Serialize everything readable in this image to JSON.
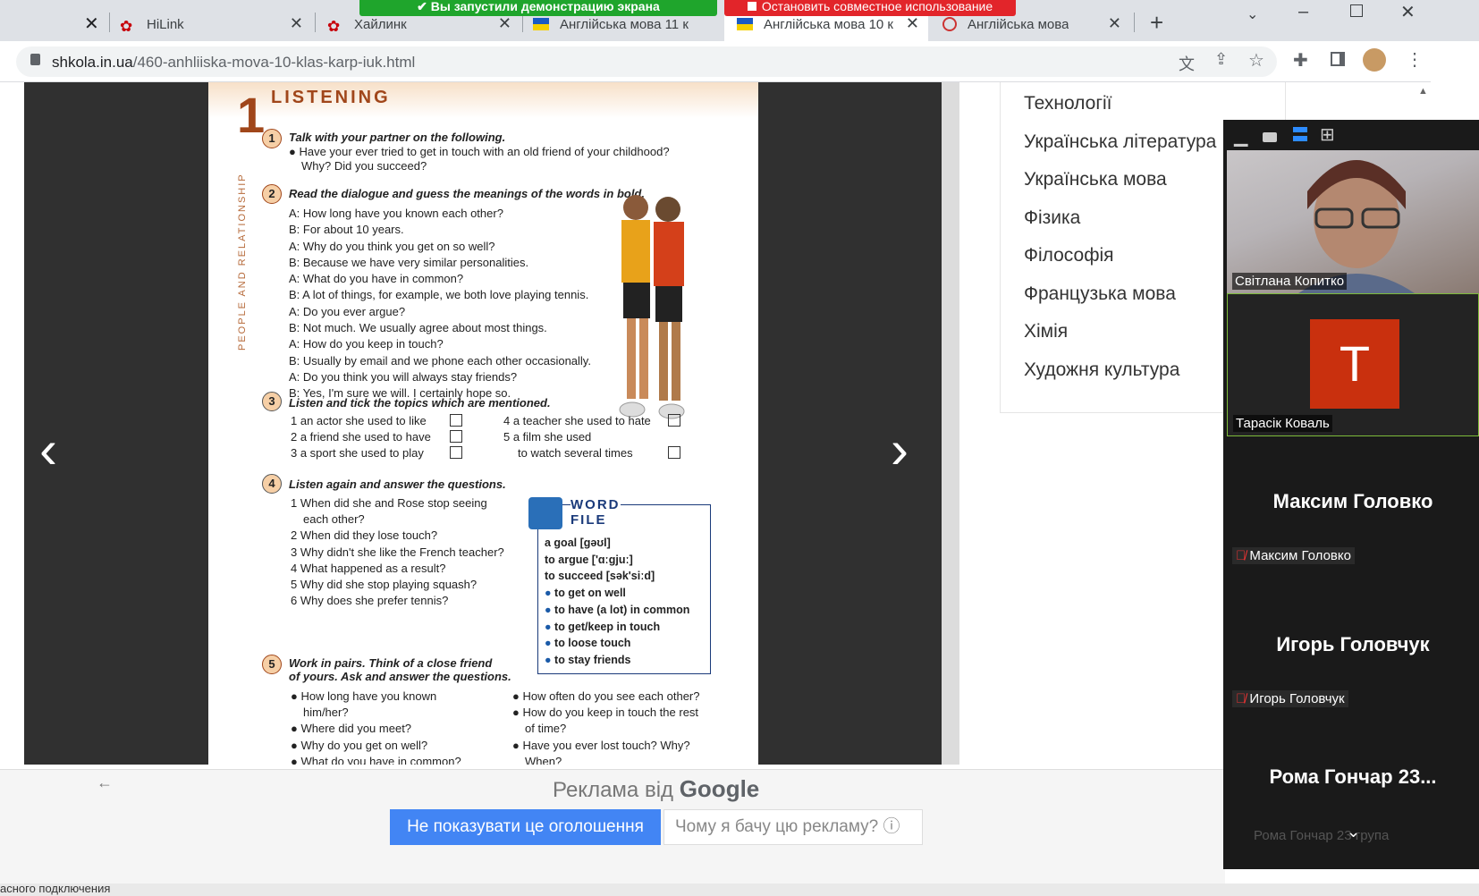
{
  "screen_share": {
    "sharing_text": "Вы запустили демонстрацию экрана",
    "stop_text": "Остановить совместное использование"
  },
  "tabs": [
    {
      "label": "HiLink"
    },
    {
      "label": "Хайлинк"
    },
    {
      "label": "Англійська мова 11 к"
    },
    {
      "label": "Англійська мова 10 к"
    },
    {
      "label": "Англійська мова"
    }
  ],
  "address": {
    "host": "shkola.in.ua",
    "path": "/460-anhliiska-mova-10-klas-karp-iuk.html"
  },
  "book": {
    "unit_number": "1",
    "section_title": "LISTENING",
    "side_label": "PEOPLE AND RELATIONSHIP",
    "ex1_num": "1",
    "ex1_title": "Talk with your partner on the following.",
    "ex1_line1": "Have your ever tried to get in touch with an old friend of your childhood?",
    "ex1_line2": "Why? Did you succeed?",
    "ex2_num": "2",
    "ex2_title": "Read the dialogue and guess the meanings of the words in bold.",
    "dialogue": [
      "A: How long have you known each other?",
      "B: For about 10 years.",
      "A: Why do you think you get on so well?",
      "B: Because we have very similar personalities.",
      "A: What do you have in common?",
      "B: A lot of things, for example, we both love playing tennis.",
      "A: Do you ever argue?",
      "B: Not much. We usually agree about most things.",
      "A: How do you keep in touch?",
      "B: Usually by email and we phone each other occasionally.",
      "A: Do you think you will always stay friends?",
      "B: Yes, I'm sure we will. I certainly hope so."
    ],
    "ex3_num": "3",
    "ex3_title": "Listen and tick the topics which are mentioned.",
    "topics": [
      "1  an actor she used to like",
      "2  a friend she used to have",
      "3  a sport she used to play",
      "4  a teacher she used to hate",
      "5  a film she used",
      "to watch several times"
    ],
    "ex4_num": "4",
    "ex4_title": "Listen again and answer the questions.",
    "questions": [
      "1  When did she and Rose stop seeing",
      "each other?",
      "2  When did they lose touch?",
      "3  Why didn't she like the French teacher?",
      "4  What happened as a result?",
      "5  Why did she stop playing squash?",
      "6  Why does she prefer tennis?"
    ],
    "word_file_title1": "WORD",
    "word_file_title2": "FILE",
    "word_file": [
      "a goal [gəʊl]",
      "to argue ['ɑːgjuː]",
      "to succeed [sək'siːd]",
      "to get on well",
      "to have (a lot) in common",
      "to get/keep in touch",
      "to loose touch",
      "to stay friends"
    ],
    "ex5_num": "5",
    "ex5_title1": "Work in pairs. Think of a close friend",
    "ex5_title2": "of yours. Ask and answer the questions.",
    "ex5_left": [
      "How long have you known",
      "him/her?",
      "Where did you meet?",
      "Why do you get on well?",
      "What do you have in common?"
    ],
    "ex5_right": [
      "How often do you see each other?",
      "How do you keep in touch the rest",
      "of time?",
      "Have you ever lost touch? Why?",
      "When?"
    ]
  },
  "subjects_menu": [
    "Технології",
    "Українська література",
    "Українська мова",
    "Фізика",
    "Філософія",
    "Французька мова",
    "Хімія",
    "Художня культура"
  ],
  "ad": {
    "ad_by": "Реклама від",
    "google": "Google",
    "hide_button": "Не показувати це оголошення",
    "why_button": "Чому я бачу цю рекламу?"
  },
  "status_text": "асного подключения",
  "zoom": {
    "participants": [
      {
        "name": "Світлана Копитко",
        "type": "video"
      },
      {
        "name": "Тарасік Коваль",
        "type": "avatar",
        "initial": "Т",
        "avatar_color": "#c9300e"
      },
      {
        "name": "Максим Головко",
        "type": "name",
        "muted": true
      },
      {
        "name": "Игорь Головчук",
        "type": "name",
        "muted": true
      },
      {
        "name": "Рома Гончар 23...",
        "type": "name",
        "muted": true,
        "footer": "Рома Гончар 23 група"
      }
    ]
  }
}
